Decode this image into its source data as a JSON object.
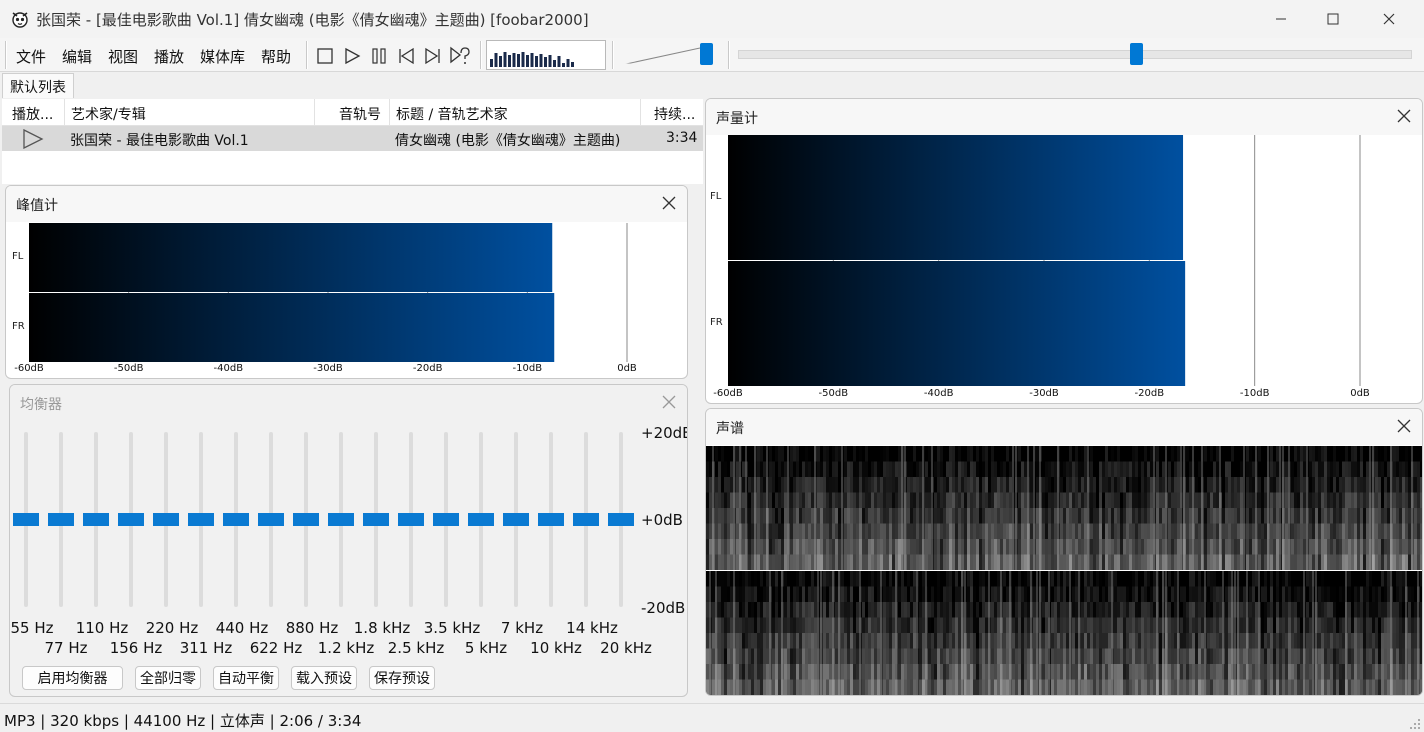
{
  "window": {
    "title": "张国荣 - [最佳电影歌曲 Vol.1] 倩女幽魂 (电影《倩女幽魂》主题曲)  [foobar2000]"
  },
  "menu": [
    "文件",
    "编辑",
    "视图",
    "播放",
    "媒体库",
    "帮助"
  ],
  "transport_icons": [
    "stop-icon",
    "play-icon",
    "pause-icon",
    "previous-icon",
    "next-icon",
    "random-icon"
  ],
  "seekbar": {
    "position_fraction": 0.59
  },
  "volume": {
    "level_fraction": 0.95
  },
  "mini_visualizer": {
    "levels": [
      0.4,
      0.7,
      0.55,
      0.75,
      0.6,
      0.7,
      0.65,
      0.75,
      0.6,
      0.7,
      0.55,
      0.65,
      0.5,
      0.6,
      0.35,
      0.55,
      0.2,
      0.4,
      0.25
    ]
  },
  "tabs": [
    "默认列表"
  ],
  "playlist": {
    "columns": [
      "播放...",
      "艺术家/专辑",
      "音轨号",
      "标题 / 音轨艺术家",
      "持续..."
    ],
    "rows": [
      {
        "artist_album": "张国荣 - 最佳电影歌曲 Vol.1",
        "track_no": "",
        "title": "倩女幽魂 (电影《倩女幽魂》主题曲)",
        "duration": "3:34"
      }
    ]
  },
  "peak_meter": {
    "title": "峰值计",
    "channels": [
      {
        "name": "FL",
        "level_db": -7.5
      },
      {
        "name": "FR",
        "level_db": -7.3
      }
    ],
    "ticks": [
      "-60dB",
      "-50dB",
      "-40dB",
      "-30dB",
      "-20dB",
      "-10dB",
      "0dB"
    ],
    "range_db": [
      -60,
      0
    ]
  },
  "loudness_meter": {
    "title": "声量计",
    "channels": [
      {
        "name": "FL",
        "level_db": -16.8
      },
      {
        "name": "FR",
        "level_db": -16.6
      }
    ],
    "ticks": [
      "-60dB",
      "-50dB",
      "-40dB",
      "-30dB",
      "-20dB",
      "-10dB",
      "0dB"
    ],
    "range_db": [
      -60,
      0
    ]
  },
  "equalizer": {
    "title": "均衡器",
    "db_labels": [
      "+20dB",
      "+0dB",
      "-20dB"
    ],
    "bands_top": [
      "55 Hz",
      "110 Hz",
      "220 Hz",
      "440 Hz",
      "880 Hz",
      "1.8 kHz",
      "3.5 kHz",
      "7 kHz",
      "14 kHz"
    ],
    "bands_bottom": [
      "77 Hz",
      "156 Hz",
      "311 Hz",
      "622 Hz",
      "1.2 kHz",
      "2.5 kHz",
      "5 kHz",
      "10 kHz",
      "20 kHz"
    ],
    "gains_db": [
      0,
      0,
      0,
      0,
      0,
      0,
      0,
      0,
      0,
      0,
      0,
      0,
      0,
      0,
      0,
      0,
      0,
      0
    ],
    "buttons": [
      "启用均衡器",
      "全部归零",
      "自动平衡",
      "载入预设",
      "保存预设"
    ]
  },
  "spectrogram": {
    "title": "声谱"
  },
  "status": "MP3 | 320 kbps | 44100 Hz | 立体声 | 2:06 / 3:34",
  "colors": {
    "accent": "#0078d4",
    "meter_end": "#0050a0",
    "meter_start": "#000000"
  }
}
